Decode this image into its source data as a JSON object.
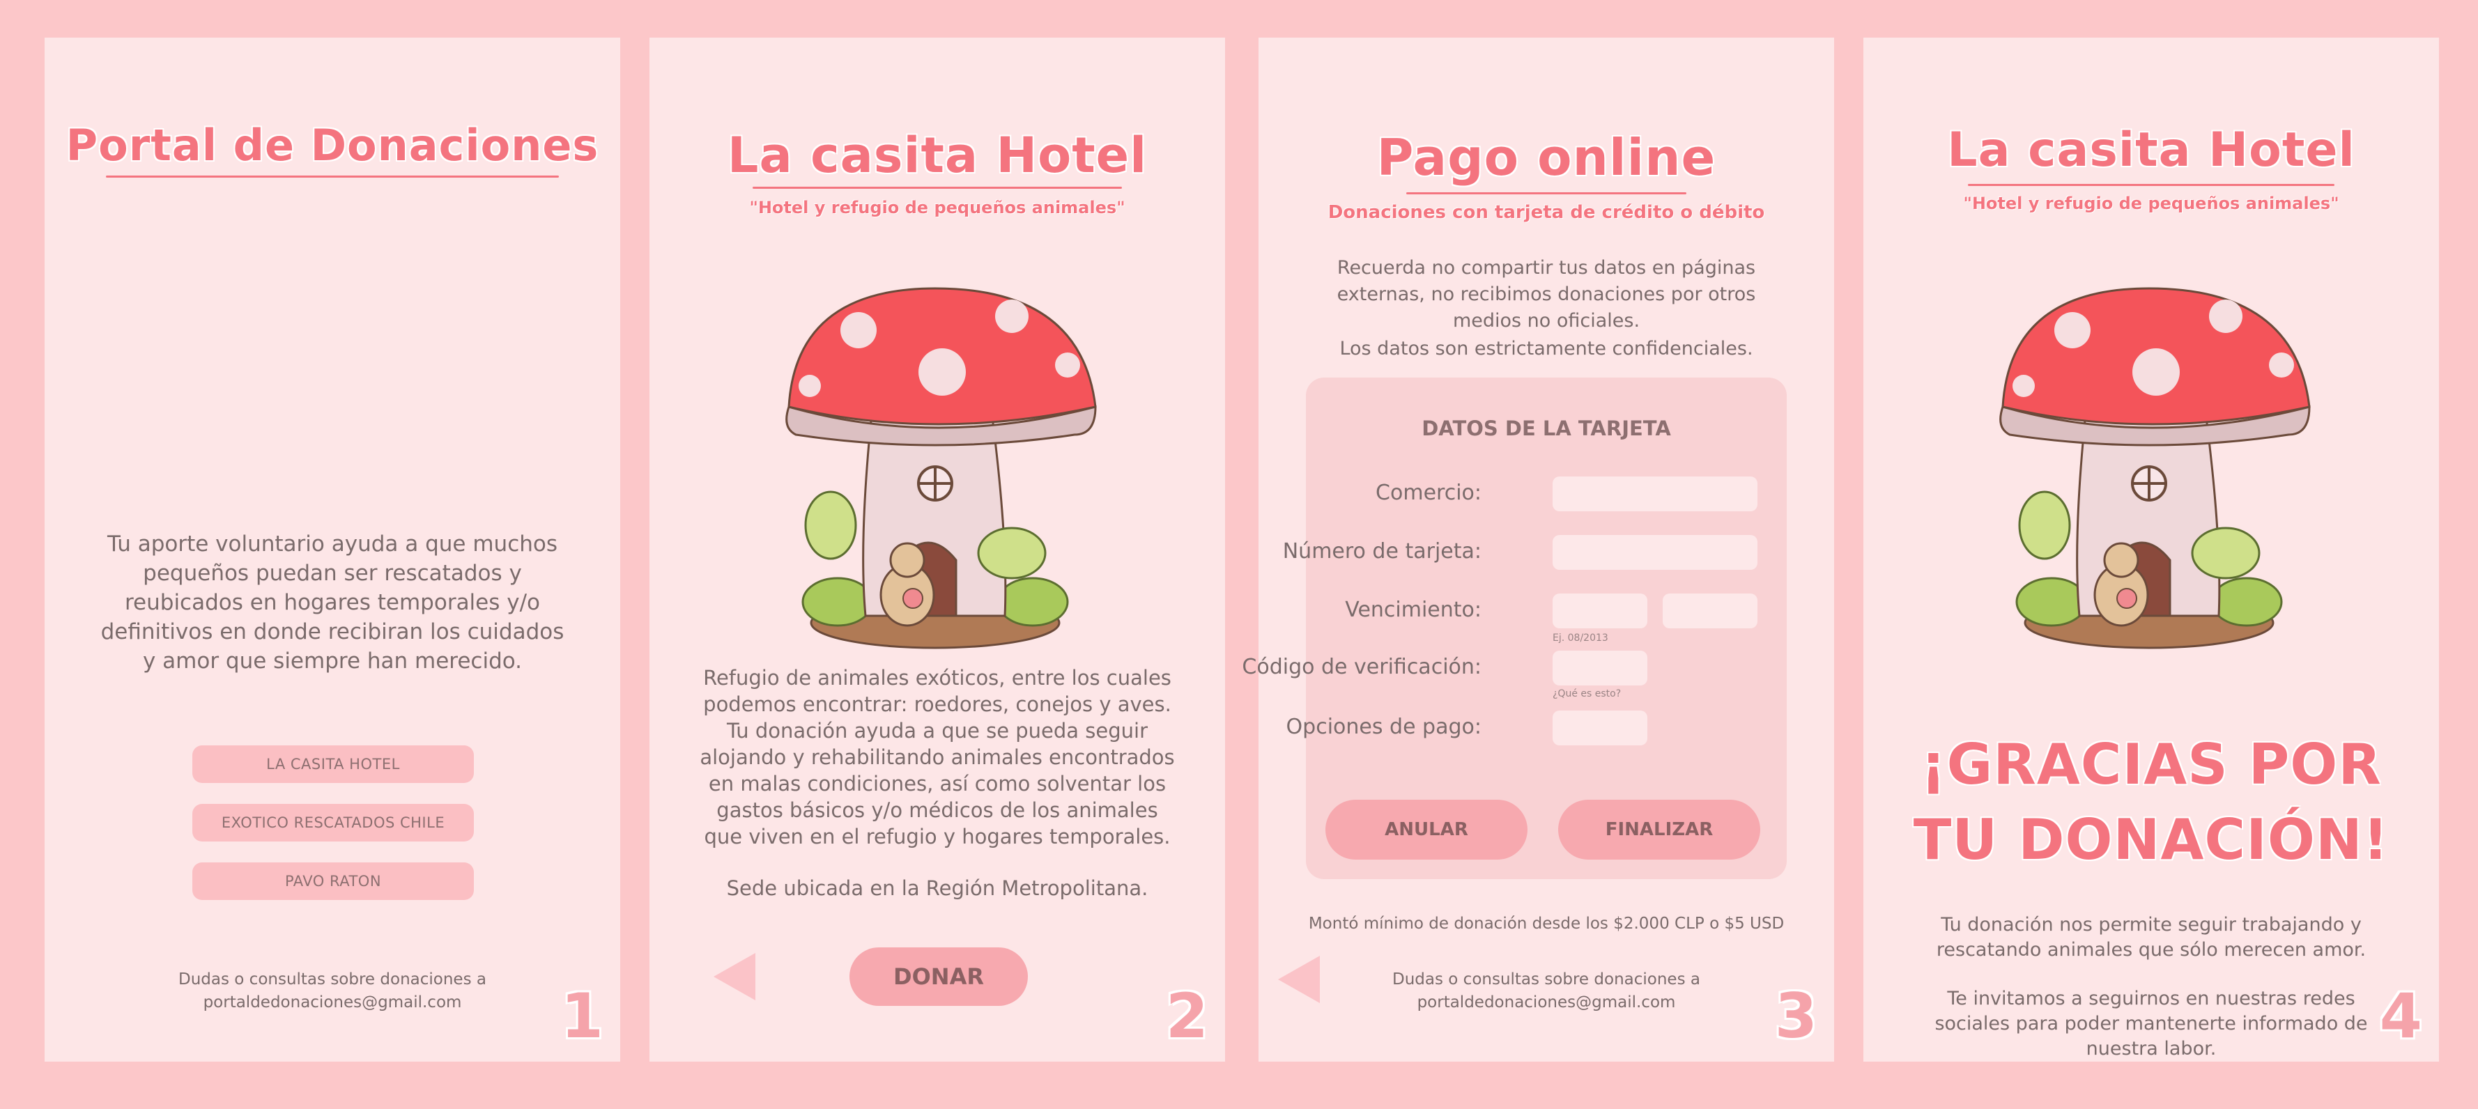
{
  "panel1": {
    "title": "Portal de Donaciones",
    "description": "Tu aporte voluntario ayuda a que muchos pequeños puedan ser rescatados y reubicados en hogares temporales y/o definitivos en donde recibiran los cuidados y amor que siempre han merecido.",
    "buttons": [
      "LA CASITA HOTEL",
      "EXOTICO RESCATADOS CHILE",
      "PAVO RATON"
    ],
    "footer_line1": "Dudas o consultas sobre donaciones a",
    "footer_line2": "portaldedonaciones@gmail.com",
    "number": "1"
  },
  "panel2": {
    "title": "La casita Hotel",
    "subtitle": "\"Hotel y refugio de pequeños animales\"",
    "description": "Refugio de animales exóticos, entre los cuales podemos encontrar: roedores, conejos y aves. Tu donación ayuda a que se pueda seguir alojando y rehabilitando animales encontrados en malas condiciones, así como solventar los gastos básicos y/o médicos de los animales que viven en el refugio y hogares temporales.",
    "location": "Sede ubicada en la Región Metropolitana.",
    "donate_label": "DONAR",
    "number": "2"
  },
  "panel3": {
    "title": "Pago online",
    "subtitle": "Donaciones con tarjeta de crédito o débito",
    "warning": "Recuerda no compartir tus datos en páginas externas, no recibimos donaciones por otros medios no oficiales.",
    "confidential": "Los datos son estrictamente confidenciales.",
    "form_title": "DATOS DE LA TARJETA",
    "fields": {
      "comercio": "Comercio:",
      "numero": "Número de tarjeta:",
      "vencimiento": "Vencimiento:",
      "vencimiento_hint": "Ej. 08/2013",
      "codigo": "Código de verificación:",
      "codigo_hint": "¿Qué es esto?",
      "opciones": "Opciones de pago:"
    },
    "cancel_label": "ANULAR",
    "finish_label": "FINALIZAR",
    "minimum": "Montó mínimo de donación desde los $2.000 CLP o $5 USD",
    "footer_line1": "Dudas o consultas sobre donaciones a",
    "footer_line2": "portaldedonaciones@gmail.com",
    "number": "3"
  },
  "panel4": {
    "title": "La casita Hotel",
    "subtitle": "\"Hotel y refugio de pequeños animales\"",
    "thanks_line1": "¡GRACIAS POR",
    "thanks_line2": "TU DONACIÓN!",
    "message1": "Tu donación nos permite seguir trabajando y rescatando animales que sólo merecen amor.",
    "message2": "Te invitamos a seguirnos en nuestras redes sociales para poder mantenerte informado de nuestra labor.",
    "number": "4"
  },
  "colors": {
    "background": "#fcc7c9",
    "panel": "#fde6e7",
    "accent": "#f4747f",
    "button": "#f7a9af"
  }
}
